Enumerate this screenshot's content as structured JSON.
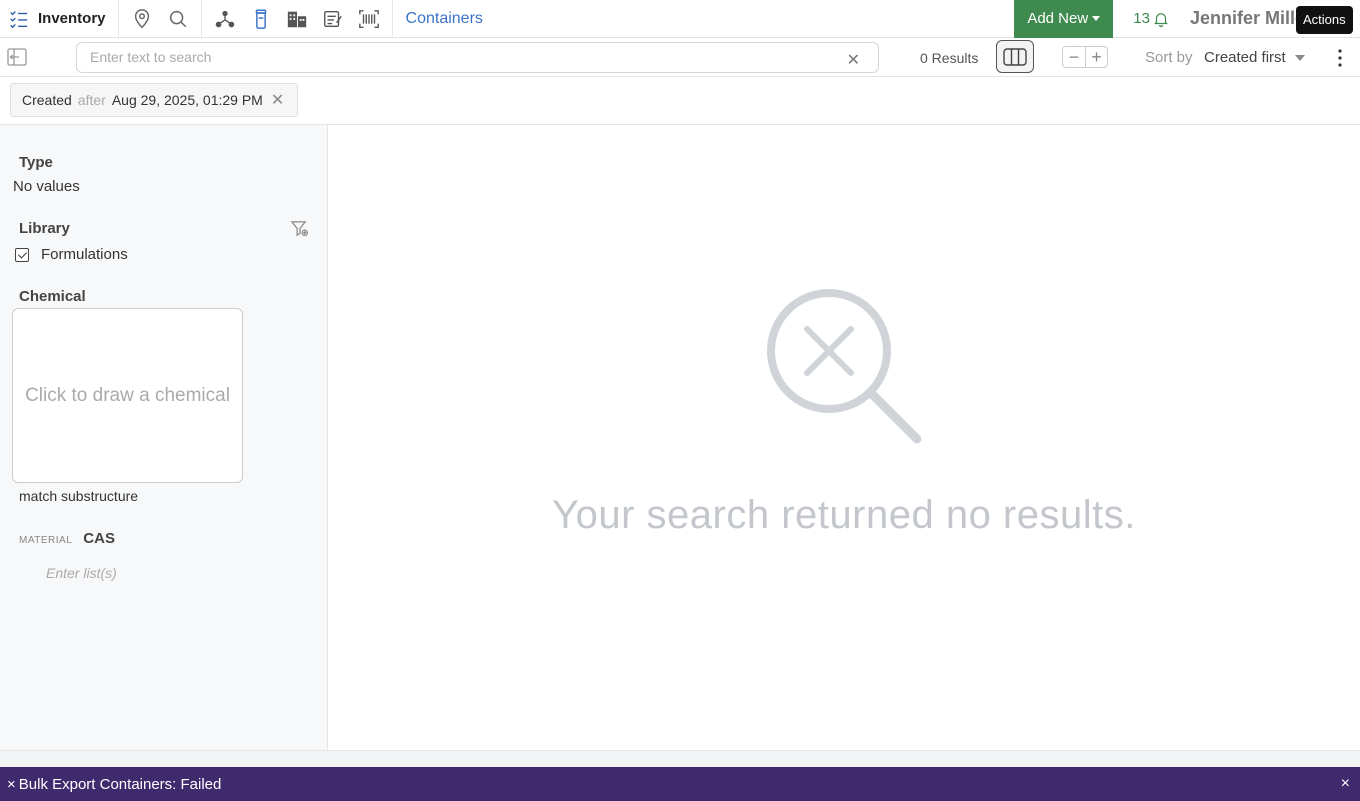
{
  "app": {
    "brand": "Inventory",
    "breadcrumb": "Containers",
    "add_new": "Add New",
    "notification_count": "13",
    "user_name": "Jennifer Miller",
    "tooltip": "Actions"
  },
  "colors": {
    "accent": "#3b73c8",
    "add_new_bg": "#3f8a4e",
    "toast_bg": "#3f2a6e"
  },
  "toolbar_icons": [
    "inventory-list-icon",
    "location-pin-icon",
    "search-icon",
    "molecule-icon",
    "container-icon",
    "buildings-icon",
    "notes-icon",
    "barcode-scan-icon",
    "bell-icon",
    "apps-grid-icon"
  ],
  "search": {
    "placeholder": "Enter text to search",
    "value": "",
    "results": "0 Results",
    "sort_by_label": "Sort by",
    "sort_by_value": "Created first"
  },
  "filter_chip": {
    "field": "Created",
    "op": "after",
    "value": "Aug 29, 2025, 01:29 PM"
  },
  "sidebar": {
    "type_title": "Type",
    "type_empty": "No values",
    "library_title": "Library",
    "library_item": "Formulations",
    "library_item_checked": true,
    "chemical_title": "Chemical",
    "draw_prompt": "Click to draw a chemical",
    "match_substructure": "match substructure",
    "cas_prefix": "MATERIAL",
    "cas_title": "CAS",
    "cas_placeholder": "Enter list(s)"
  },
  "main": {
    "empty_message": "Your search returned no results."
  },
  "toast": {
    "message": "Bulk Export Containers: Failed",
    "prefix_icon": "×",
    "close": "×"
  }
}
